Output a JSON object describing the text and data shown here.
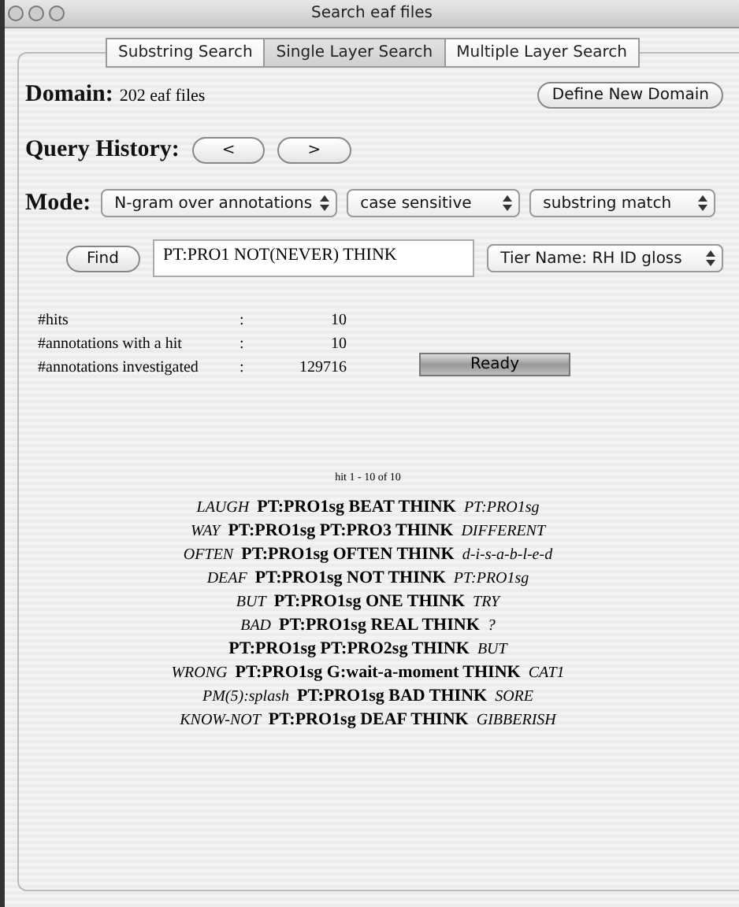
{
  "window": {
    "title": "Search eaf files"
  },
  "tabs": [
    {
      "label": "Substring Search",
      "selected": false
    },
    {
      "label": "Single Layer Search",
      "selected": true
    },
    {
      "label": "Multiple Layer Search",
      "selected": false
    }
  ],
  "domain": {
    "label": "Domain:",
    "value": "202 eaf files",
    "button": "Define New Domain"
  },
  "query_history": {
    "label": "Query History:",
    "back": "<",
    "forward": ">"
  },
  "mode": {
    "label": "Mode:",
    "selects": [
      "N-gram over annotations",
      "case sensitive",
      "substring match"
    ]
  },
  "find": {
    "button": "Find",
    "query": "PT:PRO1 NOT(NEVER) THINK",
    "tier": "Tier Name: RH ID gloss"
  },
  "stats": [
    {
      "label": "#hits",
      "sep": ":",
      "value": "10"
    },
    {
      "label": "#annotations with a hit",
      "sep": ":",
      "value": "10"
    },
    {
      "label": "#annotations investigated",
      "sep": ":",
      "value": "129716"
    }
  ],
  "status": "Ready",
  "results": {
    "header": "hit 1 - 10 of 10",
    "hits": [
      {
        "left": "LAUGH",
        "match": "PT:PRO1sg BEAT THINK",
        "right": "PT:PRO1sg"
      },
      {
        "left": "WAY",
        "match": "PT:PRO1sg PT:PRO3 THINK",
        "right": "DIFFERENT"
      },
      {
        "left": "OFTEN",
        "match": "PT:PRO1sg OFTEN THINK",
        "right": "d-i-s-a-b-l-e-d"
      },
      {
        "left": "DEAF",
        "match": "PT:PRO1sg NOT THINK",
        "right": "PT:PRO1sg"
      },
      {
        "left": "BUT",
        "match": "PT:PRO1sg ONE THINK",
        "right": "TRY"
      },
      {
        "left": "BAD",
        "match": "PT:PRO1sg REAL THINK",
        "right": "?"
      },
      {
        "match": "PT:PRO1sg PT:PRO2sg THINK",
        "right": "BUT"
      },
      {
        "left": "WRONG",
        "match": "PT:PRO1sg G:wait-a-moment THINK",
        "right": "CAT1"
      },
      {
        "left": "PM(5):splash",
        "match": "PT:PRO1sg BAD THINK",
        "right": "SORE"
      },
      {
        "left": "KNOW-NOT",
        "match": "PT:PRO1sg DEAF THINK",
        "right": "GIBBERISH"
      }
    ]
  }
}
